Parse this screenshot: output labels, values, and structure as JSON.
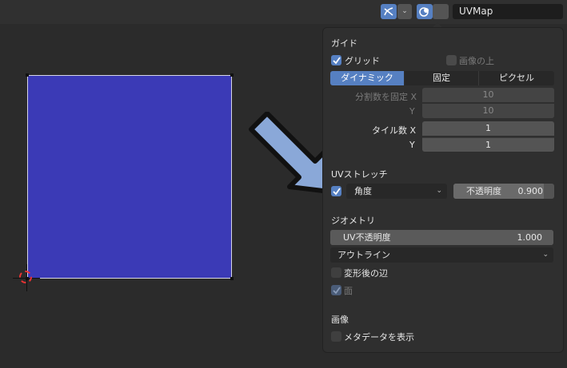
{
  "header": {
    "uvmap": "UVMap",
    "dropdown_glyph": "⌄"
  },
  "popover": {
    "guide": {
      "title": "ガイド",
      "grid_label": "グリッド",
      "grid_checked": true,
      "over_image_label": "画像の上",
      "over_image_checked": false,
      "modes": [
        "ダイナミック",
        "固定",
        "ピクセル"
      ],
      "active_mode": "ダイナミック",
      "fixed_subdiv_label": "分割数を固定 X",
      "fixed_subdiv_x": "10",
      "y_label": "Y",
      "fixed_subdiv_y": "10",
      "tiles_label": "タイル数 X",
      "tiles_x": "1",
      "tiles_y_label": "Y",
      "tiles_y": "1"
    },
    "uv_stretch": {
      "title": "UVストレッチ",
      "checked": true,
      "mode": "角度",
      "opacity_label": "不透明度",
      "opacity_value": "0.900",
      "opacity_fraction": 0.9
    },
    "geometry": {
      "title": "ジオメトリ",
      "uv_opacity_label": "UV不透明度",
      "uv_opacity_value": "1.000",
      "display_mode": "アウトライン",
      "modified_edges_label": "変形後の辺",
      "modified_edges_checked": false,
      "faces_label": "面",
      "faces_checked": true
    },
    "image": {
      "title": "画像",
      "show_metadata_label": "メタデータを表示",
      "show_metadata_checked": false
    }
  },
  "colors": {
    "accent": "#5680c2",
    "uv_face": "#3b3ab6",
    "arrow_fill": "#8aa8d8"
  }
}
